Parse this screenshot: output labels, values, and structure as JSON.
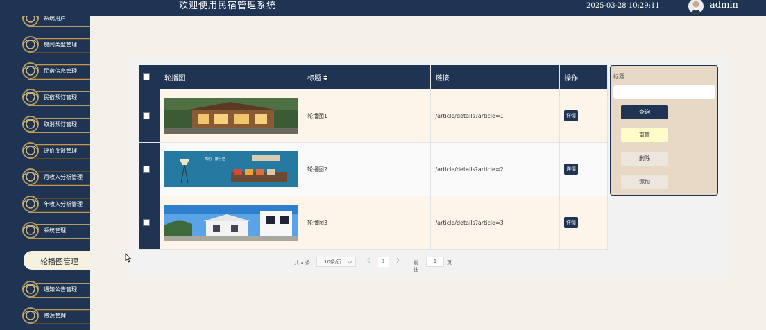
{
  "header": {
    "title": "欢迎使用民宿管理系统",
    "datetime": "2025-03-28 10:29:11",
    "username": "admin"
  },
  "sidebar": {
    "items": [
      {
        "label": "系统用户"
      },
      {
        "label": "房间类型管理"
      },
      {
        "label": "民宿信息管理"
      },
      {
        "label": "民宿预订管理"
      },
      {
        "label": "取消预订管理"
      },
      {
        "label": "评价反馈管理"
      },
      {
        "label": "月收入分析管理"
      },
      {
        "label": "年收入分析管理"
      },
      {
        "label": "系统管理"
      },
      {
        "label": "轮播图管理",
        "active": true
      },
      {
        "label": "通知公告管理"
      },
      {
        "label": "资源管理"
      }
    ]
  },
  "table": {
    "columns": [
      "轮播图",
      "标题",
      "链接",
      "操作"
    ],
    "sort_icon": "sort-icon",
    "rows": [
      {
        "title": "轮播图1",
        "link": "/article/details?article=1",
        "action": "详情",
        "image": "wooden-house-photo"
      },
      {
        "title": "轮播图2",
        "link": "/article/details?article=2",
        "action": "详情",
        "image": "living-room-banner"
      },
      {
        "title": "轮播图3",
        "link": "/article/details?article=3",
        "action": "详情",
        "image": "white-villa-photo"
      }
    ]
  },
  "banner2_text": {
    "line1": "简约 · 旅行范"
  },
  "search": {
    "label": "标题",
    "value": "",
    "buttons": {
      "query": "查询",
      "reset": "重置",
      "delete": "删除",
      "add": "添加"
    }
  },
  "pagination": {
    "total": "共 3 条",
    "page_size": "10条/页",
    "current_page": "1",
    "goto_label": "前往",
    "goto_value": "1",
    "page_unit": "页"
  },
  "colors": {
    "primary": "#1e3452",
    "gold": "#b79a61",
    "row_tint": "#fdf5ea"
  }
}
